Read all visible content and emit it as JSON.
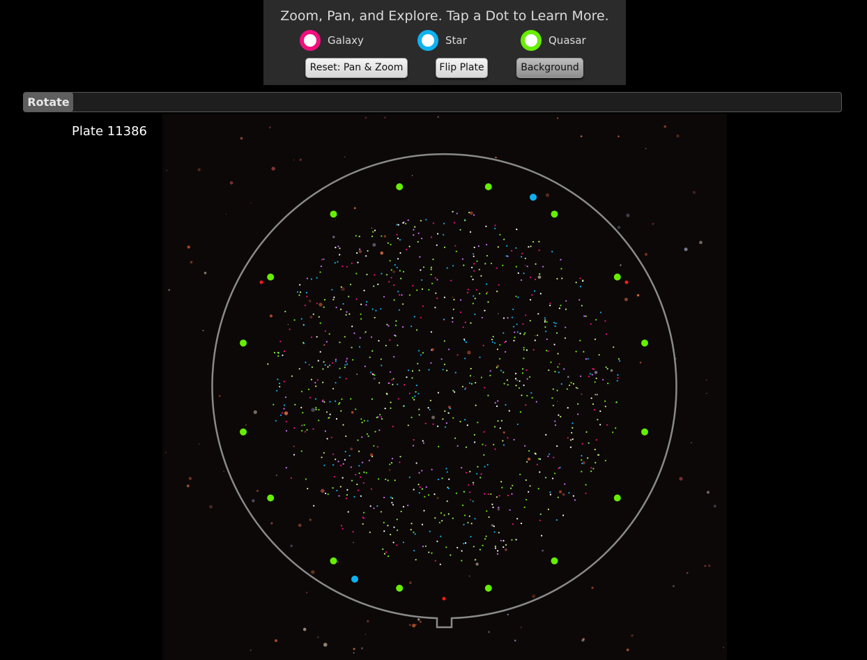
{
  "header": {
    "title": "Zoom, Pan, and Explore.  Tap a Dot to Learn More."
  },
  "legend": [
    {
      "label": "Galaxy",
      "color": "#f0107d",
      "icon": "galaxy-ring-icon"
    },
    {
      "label": "Star",
      "color": "#0db2f2",
      "icon": "star-ring-icon"
    },
    {
      "label": "Quasar",
      "color": "#66ee00",
      "icon": "quasar-ring-icon"
    }
  ],
  "buttons": {
    "reset": "Reset: Pan & Zoom",
    "flip": "Flip Plate",
    "background": "Background"
  },
  "rotate": {
    "label": "Rotate"
  },
  "plate": {
    "label": "Plate 11386",
    "ring_color": "#8a8a8a",
    "guide_color": "#66ee00",
    "star_marker_color": "#0db2f2",
    "red_marker_color": "#ff1a1a"
  }
}
